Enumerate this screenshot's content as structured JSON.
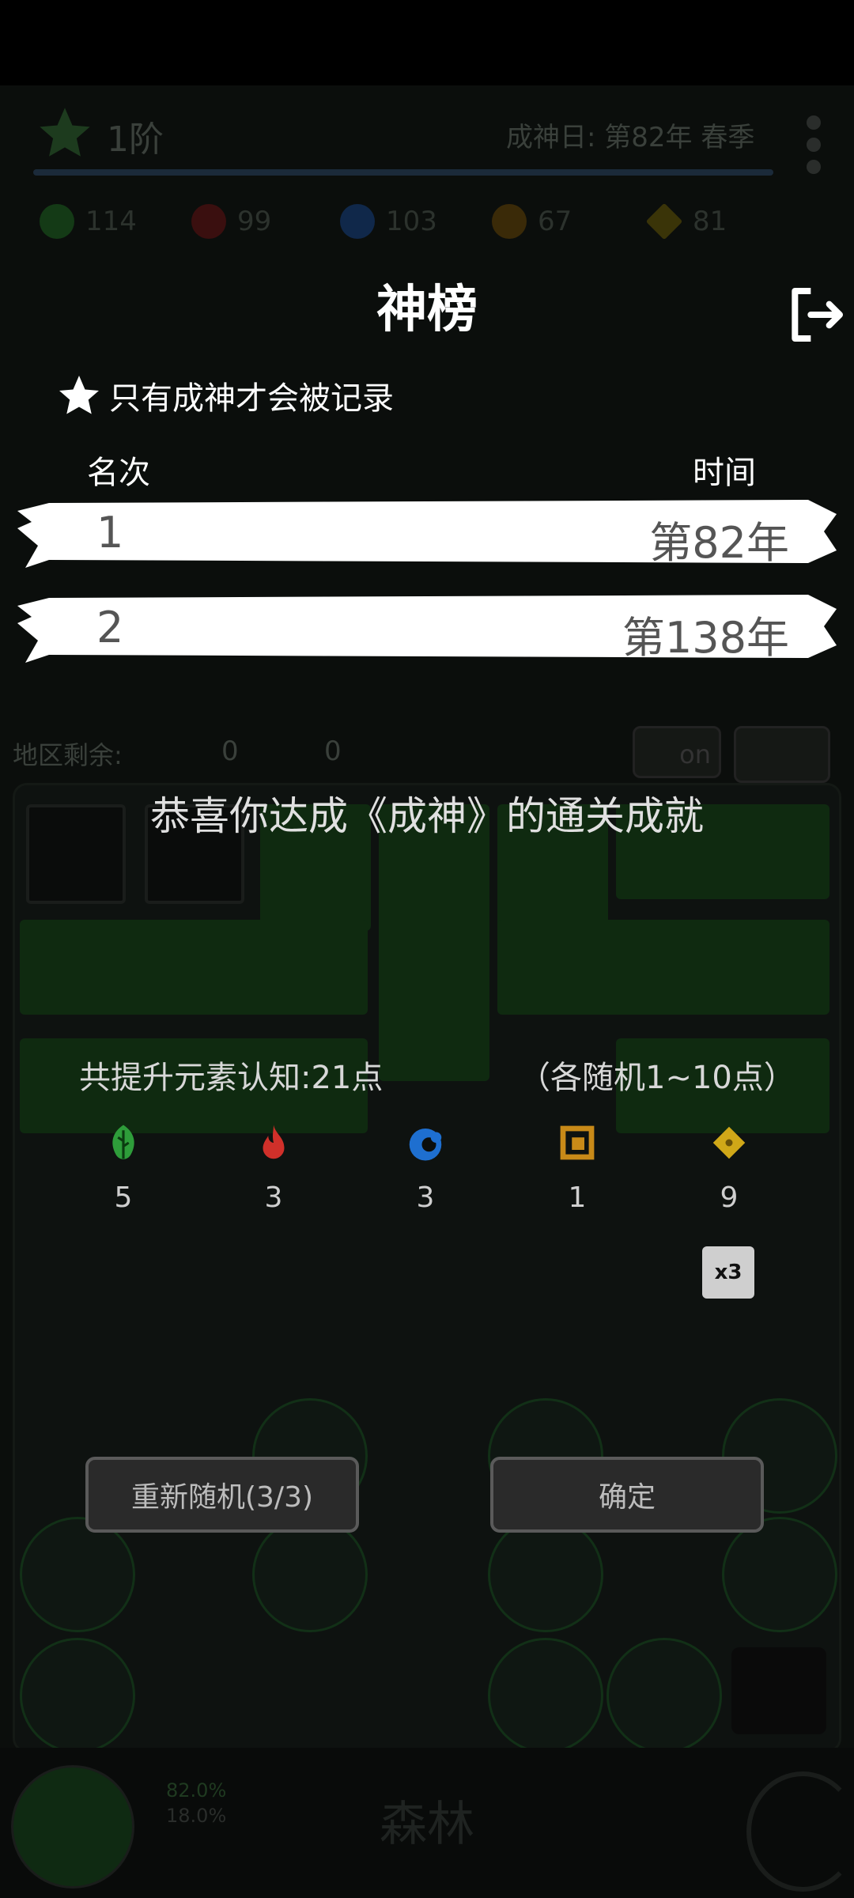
{
  "hud": {
    "rank_level": "1阶",
    "date_text": "成神日: 第82年 春季",
    "resources": [
      {
        "icon": "leaf-icon",
        "value": "114",
        "color": "#2e7d32"
      },
      {
        "icon": "fire-icon",
        "value": "99",
        "color": "#8b1a1a"
      },
      {
        "icon": "water-icon",
        "value": "103",
        "color": "#1a4f8b"
      },
      {
        "icon": "earth-icon",
        "value": "67",
        "color": "#7a5a10"
      },
      {
        "icon": "gold-icon",
        "value": "81",
        "color": "#8a7a10"
      }
    ],
    "region_left_label": "地区剩余:",
    "region_leaf": "0",
    "region_bolt": "0",
    "toggle_label": "on",
    "region_name": "森林",
    "percent_green": "82.0%",
    "percent_gray": "18.0%"
  },
  "leaderboard": {
    "title": "神榜",
    "note": "只有成神才会被记录",
    "col_rank": "名次",
    "col_time": "时间",
    "rows": [
      {
        "rank": "1",
        "time": "第82年"
      },
      {
        "rank": "2",
        "time": "第138年"
      }
    ]
  },
  "achievement": {
    "congrats": "恭喜你达成《成神》的通关成就",
    "total": "共提升元素认知:21点",
    "random_info": "（各随机1~10点）",
    "elements": [
      {
        "icon": "leaf-icon",
        "count": "5",
        "color": "#2e9d3a"
      },
      {
        "icon": "fire-icon",
        "count": "3",
        "color": "#d0302a"
      },
      {
        "icon": "water-icon",
        "count": "3",
        "color": "#1e6fd0"
      },
      {
        "icon": "earth-icon",
        "count": "1",
        "color": "#c88a18"
      },
      {
        "icon": "gold-icon",
        "count": "9",
        "color": "#d0a818"
      }
    ],
    "multiplier": "x3",
    "reroll_button": "重新随机(3/3)",
    "confirm_button": "确定"
  }
}
